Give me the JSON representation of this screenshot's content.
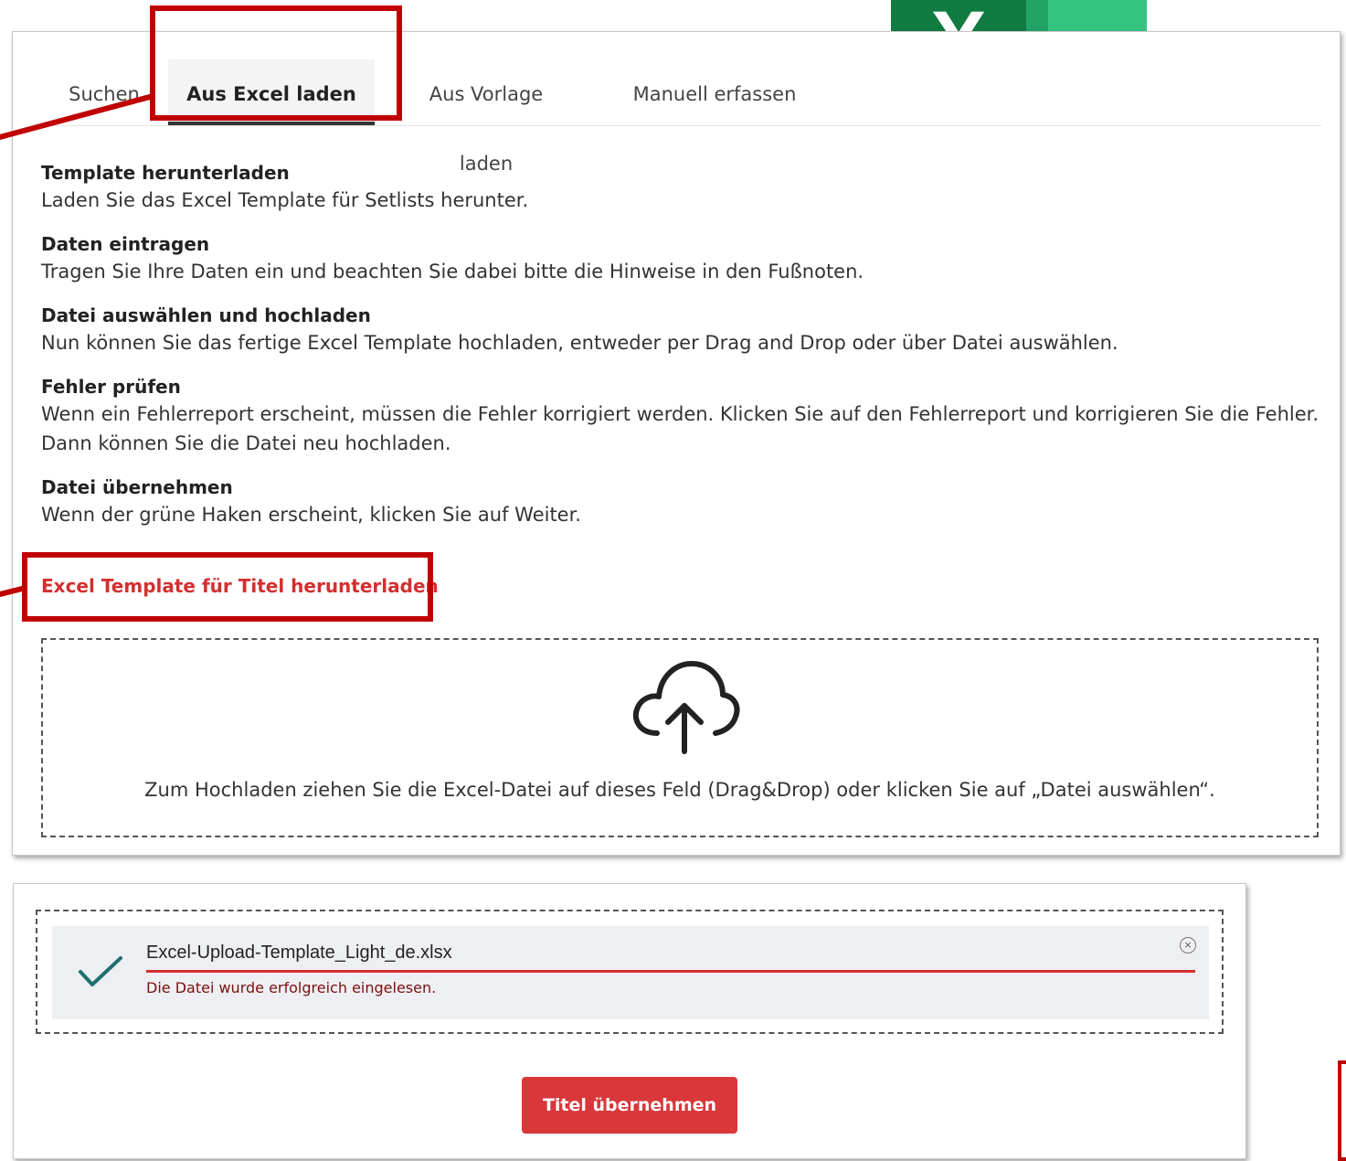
{
  "tabs": [
    {
      "label": "Suchen"
    },
    {
      "label": "Aus Excel laden"
    },
    {
      "label": "Aus Vorlage laden"
    },
    {
      "label": "Manuell erfassen"
    }
  ],
  "active_tab": "Aus Excel laden",
  "steps": [
    {
      "title": "Template herunterladen",
      "text": "Laden Sie das Excel Template für Setlists herunter."
    },
    {
      "title": "Daten eintragen",
      "text": "Tragen Sie Ihre Daten ein und beachten Sie dabei bitte die Hinweise in den Fußnoten."
    },
    {
      "title": "Datei auswählen und hochladen",
      "text": "Nun können Sie das fertige Excel Template hochladen, entweder per Drag and Drop oder über Datei auswählen."
    },
    {
      "title": "Fehler prüfen",
      "text": "Wenn ein Fehlerreport erscheint, müssen die Fehler korrigiert werden. Klicken Sie auf den Fehlerreport und korrigieren Sie die Fehler.",
      "text2": "Dann können Sie die Datei neu hochladen."
    },
    {
      "title": "Datei übernehmen",
      "text": "Wenn der grüne Haken erscheint, klicken Sie auf Weiter."
    }
  ],
  "download_link": "Excel Template für Titel herunterladen",
  "dropzone": {
    "icon": "cloud-upload-icon",
    "text": "Zum Hochladen ziehen Sie die Excel-Datei auf dieses Feld (Drag&Drop) oder klicken Sie auf „Datei auswählen“."
  },
  "excel_logo": {
    "letter": "X",
    "icon": "excel-logo-icon"
  },
  "uploaded_file": {
    "name": "Excel-Upload-Template_Light_de.xlsx",
    "status": "Die Datei wurde erfolgreich eingelesen.",
    "progress": 1.0,
    "close_symbol": "×"
  },
  "submit_button": "Titel übernehmen",
  "colors": {
    "accent_red": "#d9373a",
    "highlight_red": "#c00000",
    "check_teal": "#1f6f6f",
    "excel_green": "#107c41"
  }
}
